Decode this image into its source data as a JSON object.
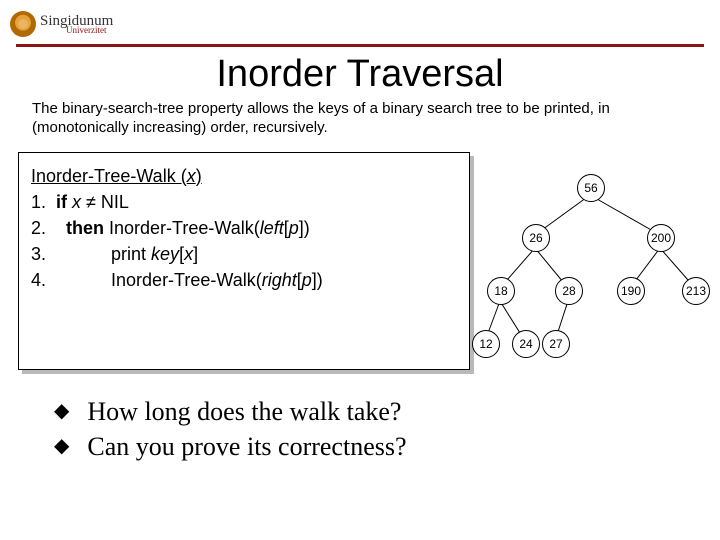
{
  "logo": {
    "name": "Singidunum",
    "tagline": "Univerzitet"
  },
  "title": "Inorder Traversal",
  "intro": "The binary-search-tree property allows the keys of a binary search tree to be printed, in (monotonically increasing) order,  recursively.",
  "algorithm": {
    "name_prefix": "Inorder-Tree-Walk (",
    "name_param": "x",
    "name_suffix": ")",
    "l1a": "1.  ",
    "l1b": "if ",
    "l1c": "x",
    "l1d": " ≠ NIL",
    "l2a": "2.    ",
    "l2b": "then",
    "l2c": " Inorder-Tree-Walk(",
    "l2d": "left",
    "l2e": "[",
    "l2f": "p",
    "l2g": "])",
    "l3a": "3.             print ",
    "l3b": "key",
    "l3c": "[",
    "l3d": "x",
    "l3e": "]",
    "l4a": "4.             Inorder-Tree-Walk(",
    "l4b": "right",
    "l4c": "[",
    "l4d": "p",
    "l4e": "])"
  },
  "tree": {
    "n56": "56",
    "n26": "26",
    "n200": "200",
    "n18": "18",
    "n28": "28",
    "n190": "190",
    "n213": "213",
    "n12": "12",
    "n24": "24",
    "n27": "27"
  },
  "questions": {
    "q1": "How long does the walk take?",
    "q2": "Can you prove its correctness?"
  }
}
